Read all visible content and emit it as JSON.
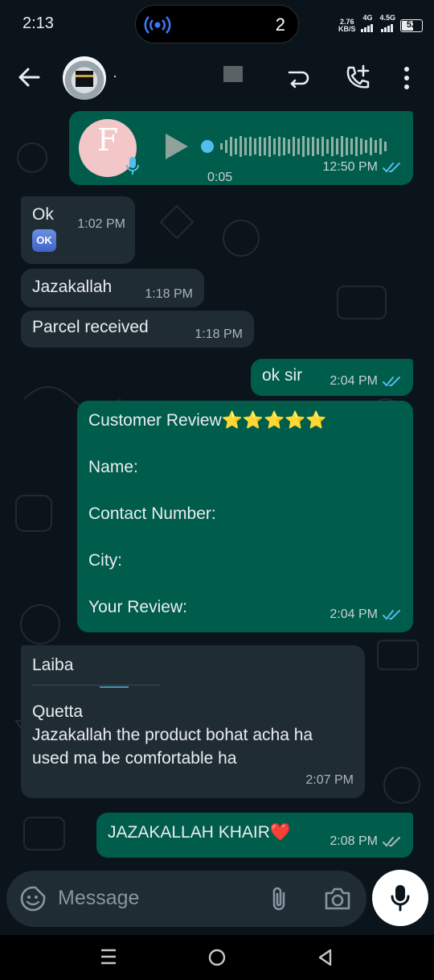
{
  "status_bar": {
    "time": "2:13",
    "pill_count": "2",
    "data_speed_top": "2.76",
    "data_speed_unit": "KB/S",
    "net1": "4G",
    "net2": "4.5G",
    "battery": "52"
  },
  "header": {
    "contact_name": "·"
  },
  "messages": {
    "voice": {
      "duration": "0:05",
      "time": "12:50 PM"
    },
    "ok": {
      "text": "Ok",
      "time": "1:02 PM",
      "emoji": "OK"
    },
    "jazak": {
      "text": "Jazakallah",
      "time": "1:18 PM"
    },
    "parcel": {
      "text": "Parcel received",
      "time": "1:18 PM"
    },
    "oksir": {
      "text": "ok sir",
      "time": "2:04 PM"
    },
    "review": {
      "title": "Customer Review⭐⭐⭐⭐⭐",
      "name": "Name:",
      "contact": "Contact Number:",
      "city": "City:",
      "your_review": "Your Review:",
      "time": "2:04 PM"
    },
    "laiba": {
      "line1": "Laiba",
      "line2": "Quetta",
      "line3": "Jazakallah the product bohat acha ha used ma be comfortable ha",
      "time": "2:07 PM"
    },
    "khair": {
      "text": "JAZAKALLAH KHAIR❤️",
      "time": "2:08 PM"
    }
  },
  "input": {
    "placeholder": "Message"
  },
  "colors": {
    "bg": "#0b141a",
    "incoming": "#202c33",
    "outgoing": "#005c4b",
    "read_tick": "#53bdeb"
  }
}
